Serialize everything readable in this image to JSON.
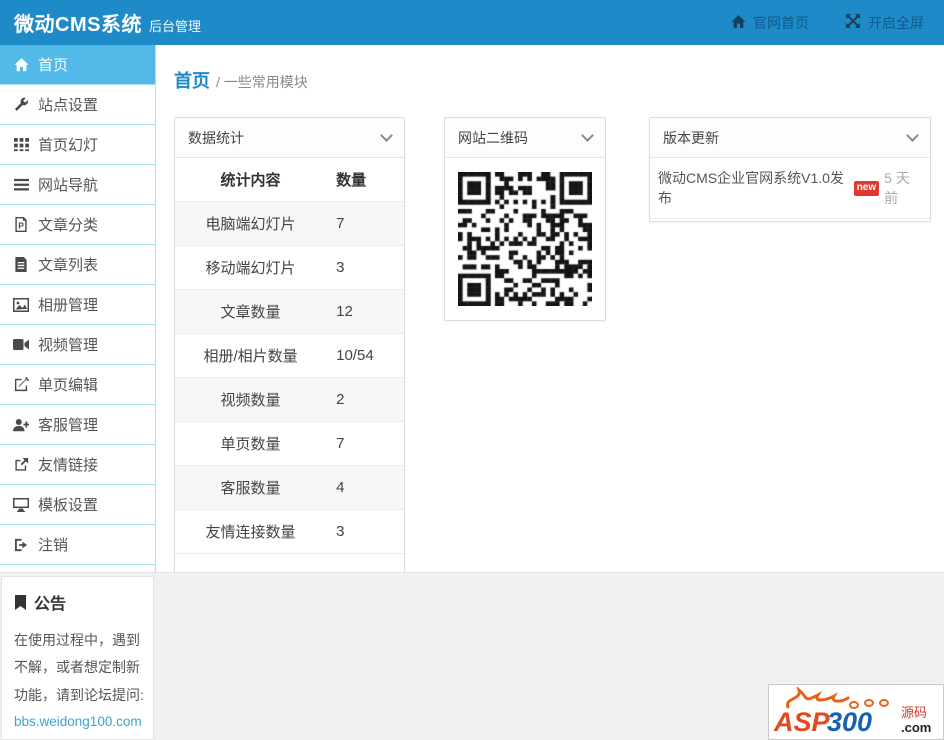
{
  "header": {
    "title": "微动CMS系统",
    "subtitle": "后台管理",
    "links": [
      {
        "id": "site-home",
        "label": "官网首页",
        "icon": "home-icon"
      },
      {
        "id": "fullscreen",
        "label": "开启全屏",
        "icon": "fullscreen-icon"
      }
    ]
  },
  "sidebar": {
    "items": [
      {
        "id": "home",
        "label": "首页",
        "icon": "home-icon",
        "active": true
      },
      {
        "id": "site-settings",
        "label": "站点设置",
        "icon": "wrench-icon",
        "active": false
      },
      {
        "id": "home-slides",
        "label": "首页幻灯",
        "icon": "grid-icon",
        "active": false
      },
      {
        "id": "site-nav",
        "label": "网站导航",
        "icon": "list-icon",
        "active": false
      },
      {
        "id": "article-category",
        "label": "文章分类",
        "icon": "file-p-icon",
        "active": false
      },
      {
        "id": "article-list",
        "label": "文章列表",
        "icon": "file-text-icon",
        "active": false
      },
      {
        "id": "album-manage",
        "label": "相册管理",
        "icon": "photo-icon",
        "active": false
      },
      {
        "id": "video-manage",
        "label": "视频管理",
        "icon": "video-camera-icon",
        "active": false
      },
      {
        "id": "page-edit",
        "label": "单页编辑",
        "icon": "edit-icon",
        "active": false
      },
      {
        "id": "service-manage",
        "label": "客服管理",
        "icon": "user-plus-icon",
        "active": false
      },
      {
        "id": "friend-links",
        "label": "友情链接",
        "icon": "external-link-icon",
        "active": false
      },
      {
        "id": "template-settings",
        "label": "模板设置",
        "icon": "monitor-icon",
        "active": false
      },
      {
        "id": "logout",
        "label": "注销",
        "icon": "logout-icon",
        "active": false
      }
    ]
  },
  "breadcrumb": {
    "current": "首页",
    "trail": "/ 一些常用模块"
  },
  "panels": {
    "stats": {
      "title": "数据统计",
      "columns": [
        "统计内容",
        "数量"
      ],
      "rows": [
        {
          "label": "电脑端幻灯片",
          "value": "7"
        },
        {
          "label": "移动端幻灯片",
          "value": "3"
        },
        {
          "label": "文章数量",
          "value": "12"
        },
        {
          "label": "相册/相片数量",
          "value": "10/54"
        },
        {
          "label": "视频数量",
          "value": "2"
        },
        {
          "label": "单页数量",
          "value": "7"
        },
        {
          "label": "客服数量",
          "value": "4"
        },
        {
          "label": "友情连接数量",
          "value": "3"
        }
      ]
    },
    "qrcode": {
      "title": "网站二维码",
      "modules": 29,
      "seed": 7,
      "size": 134
    },
    "updates": {
      "title": "版本更新",
      "items": [
        {
          "text": "微动CMS企业官网系统V1.0发布",
          "badge": "new",
          "time": "5 天前"
        }
      ]
    }
  },
  "announcement": {
    "title": "公告",
    "body": "在使用过程中，遇到不解，或者想定制新功能，请到论坛提问:",
    "link": "bbs.weidong100.com"
  },
  "watermark": {
    "part1": "ASP",
    "part2": "300",
    "suffix1": "源码",
    "suffix2": ".com"
  },
  "colors": {
    "accent": "#1e8bc8",
    "active_item": "#53b9e9",
    "sidebar_divider": "#a8e3ef",
    "badge_red": "#e0392f",
    "link_blue": "#3aa3d6",
    "content_gray": "#f1f1f1"
  }
}
